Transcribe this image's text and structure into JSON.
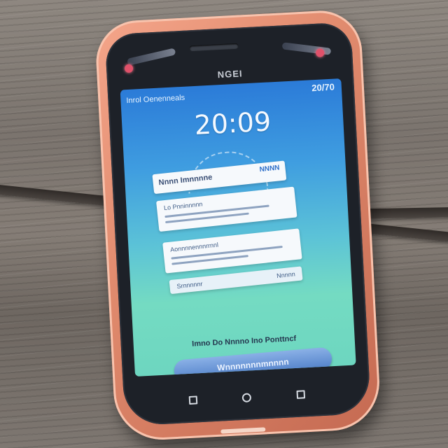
{
  "phone": {
    "brand": "NGEI",
    "status": {
      "carrier": "Inrol Oenenneals",
      "right": "20/70"
    },
    "clock": "20:09",
    "cards": [
      {
        "title": "Nnnn Imnnnne",
        "meta": "NNNN"
      },
      {
        "text": "Lo Pnninnnnn",
        "right": ""
      },
      {
        "text": "Aonnnnennnrrnnl",
        "right": ""
      },
      {
        "text": "Srnnnnnr",
        "right": "Nnnnn"
      }
    ],
    "prompt": "Imno Do Nnnno Ino Ponttncf",
    "action_label": "Wnnnnnnnmnnnn",
    "nav": [
      "back-icon",
      "home-icon",
      "recent-apps-icon"
    ]
  }
}
